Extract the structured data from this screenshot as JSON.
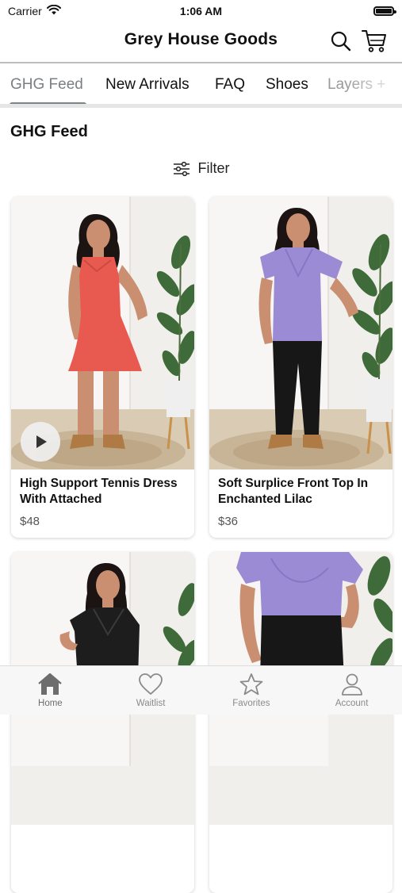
{
  "status_bar": {
    "carrier": "Carrier",
    "time": "1:06 AM"
  },
  "header": {
    "title": "Grey House Goods"
  },
  "tabs": [
    {
      "label": "GHG Feed",
      "active": true
    },
    {
      "label": "New Arrivals"
    },
    {
      "label": "FAQ"
    },
    {
      "label": "Shoes"
    },
    {
      "label": "Layers +"
    }
  ],
  "section_title": "GHG Feed",
  "filter_label": "Filter",
  "products": [
    {
      "title": "High Support Tennis Dress With Attached",
      "price": "$48",
      "has_video": true,
      "garment_color": "#e85a4f"
    },
    {
      "title": "Soft Surplice Front Top In Enchanted Lilac",
      "price": "$36",
      "has_video": false,
      "garment_color": "#9b8bd4"
    },
    {
      "title": "",
      "price": "",
      "garment_color": "#1d1d1d"
    },
    {
      "title": "",
      "price": "",
      "garment_color": "#9b8bd4"
    }
  ],
  "bottom_nav": [
    {
      "label": "Home",
      "icon": "home-icon",
      "active": true
    },
    {
      "label": "Waitlist",
      "icon": "heart-icon"
    },
    {
      "label": "Favorites",
      "icon": "star-icon"
    },
    {
      "label": "Account",
      "icon": "person-icon"
    }
  ],
  "colors": {
    "accent": "#7d8487",
    "tab_active_text": "#7b7f83",
    "nav_bg": "#f7f7f7"
  }
}
